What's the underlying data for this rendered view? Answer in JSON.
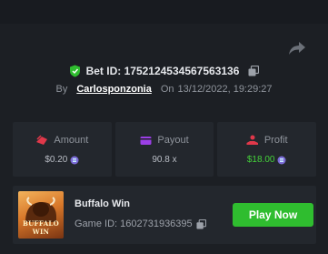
{
  "bet": {
    "id_label": "Bet ID: 1752124534567563136",
    "by_label": "By",
    "user": "Carlosponzonia",
    "on_label": "On",
    "timestamp": "13/12/2022, 19:29:27"
  },
  "stats": [
    {
      "label": "Amount",
      "value": "$0.20",
      "icon": "coins-icon",
      "value_color": "#b8bcc4"
    },
    {
      "label": "Payout",
      "value": "90.8 x",
      "icon": "wallet-icon",
      "value_color": "#b8bcc4"
    },
    {
      "label": "Profit",
      "value": "$18.00",
      "icon": "hand-coin-icon",
      "value_color": "#44d13a"
    }
  ],
  "game": {
    "title": "Buffalo Win",
    "id_label": "Game ID: 1602731936395",
    "thumbnail_text": "BUFFALO WIN",
    "play_label": "Play Now"
  },
  "colors": {
    "background": "#1c1f24",
    "card": "#23272d",
    "accent_green": "#2fbd2f",
    "profit_green": "#44d13a",
    "amount_icon": "#e0384a",
    "payout_icon": "#9b3fe6"
  }
}
